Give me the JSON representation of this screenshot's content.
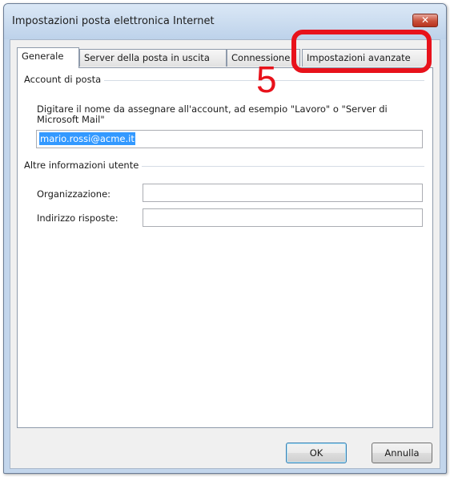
{
  "window": {
    "title": "Impostazioni posta elettronica Internet",
    "close_glyph": "✕"
  },
  "tabs": [
    {
      "label": "Generale",
      "active": true
    },
    {
      "label": "Server della posta in uscita",
      "active": false
    },
    {
      "label": "Connessione",
      "active": false
    },
    {
      "label": "Impostazioni avanzate",
      "active": false
    }
  ],
  "account_group": {
    "title": "Account di posta",
    "description": "Digitare il nome da assegnare all'account, ad esempio \"Lavoro\" o \"Server di Microsoft Mail\"",
    "account_name_value": "mario.rossi@acme.it"
  },
  "user_info_group": {
    "title": "Altre informazioni utente",
    "organization_label": "Organizzazione:",
    "organization_value": "",
    "reply_label": "Indirizzo risposte:",
    "reply_value": ""
  },
  "buttons": {
    "ok": "OK",
    "cancel": "Annulla"
  },
  "annotation": {
    "step": "5",
    "color": "#e8121b"
  },
  "colors": {
    "title_bar": "#c3d6ec",
    "close_button": "#c9503a",
    "selection": "#3399ff"
  },
  "icons": {
    "close": "close-icon"
  }
}
